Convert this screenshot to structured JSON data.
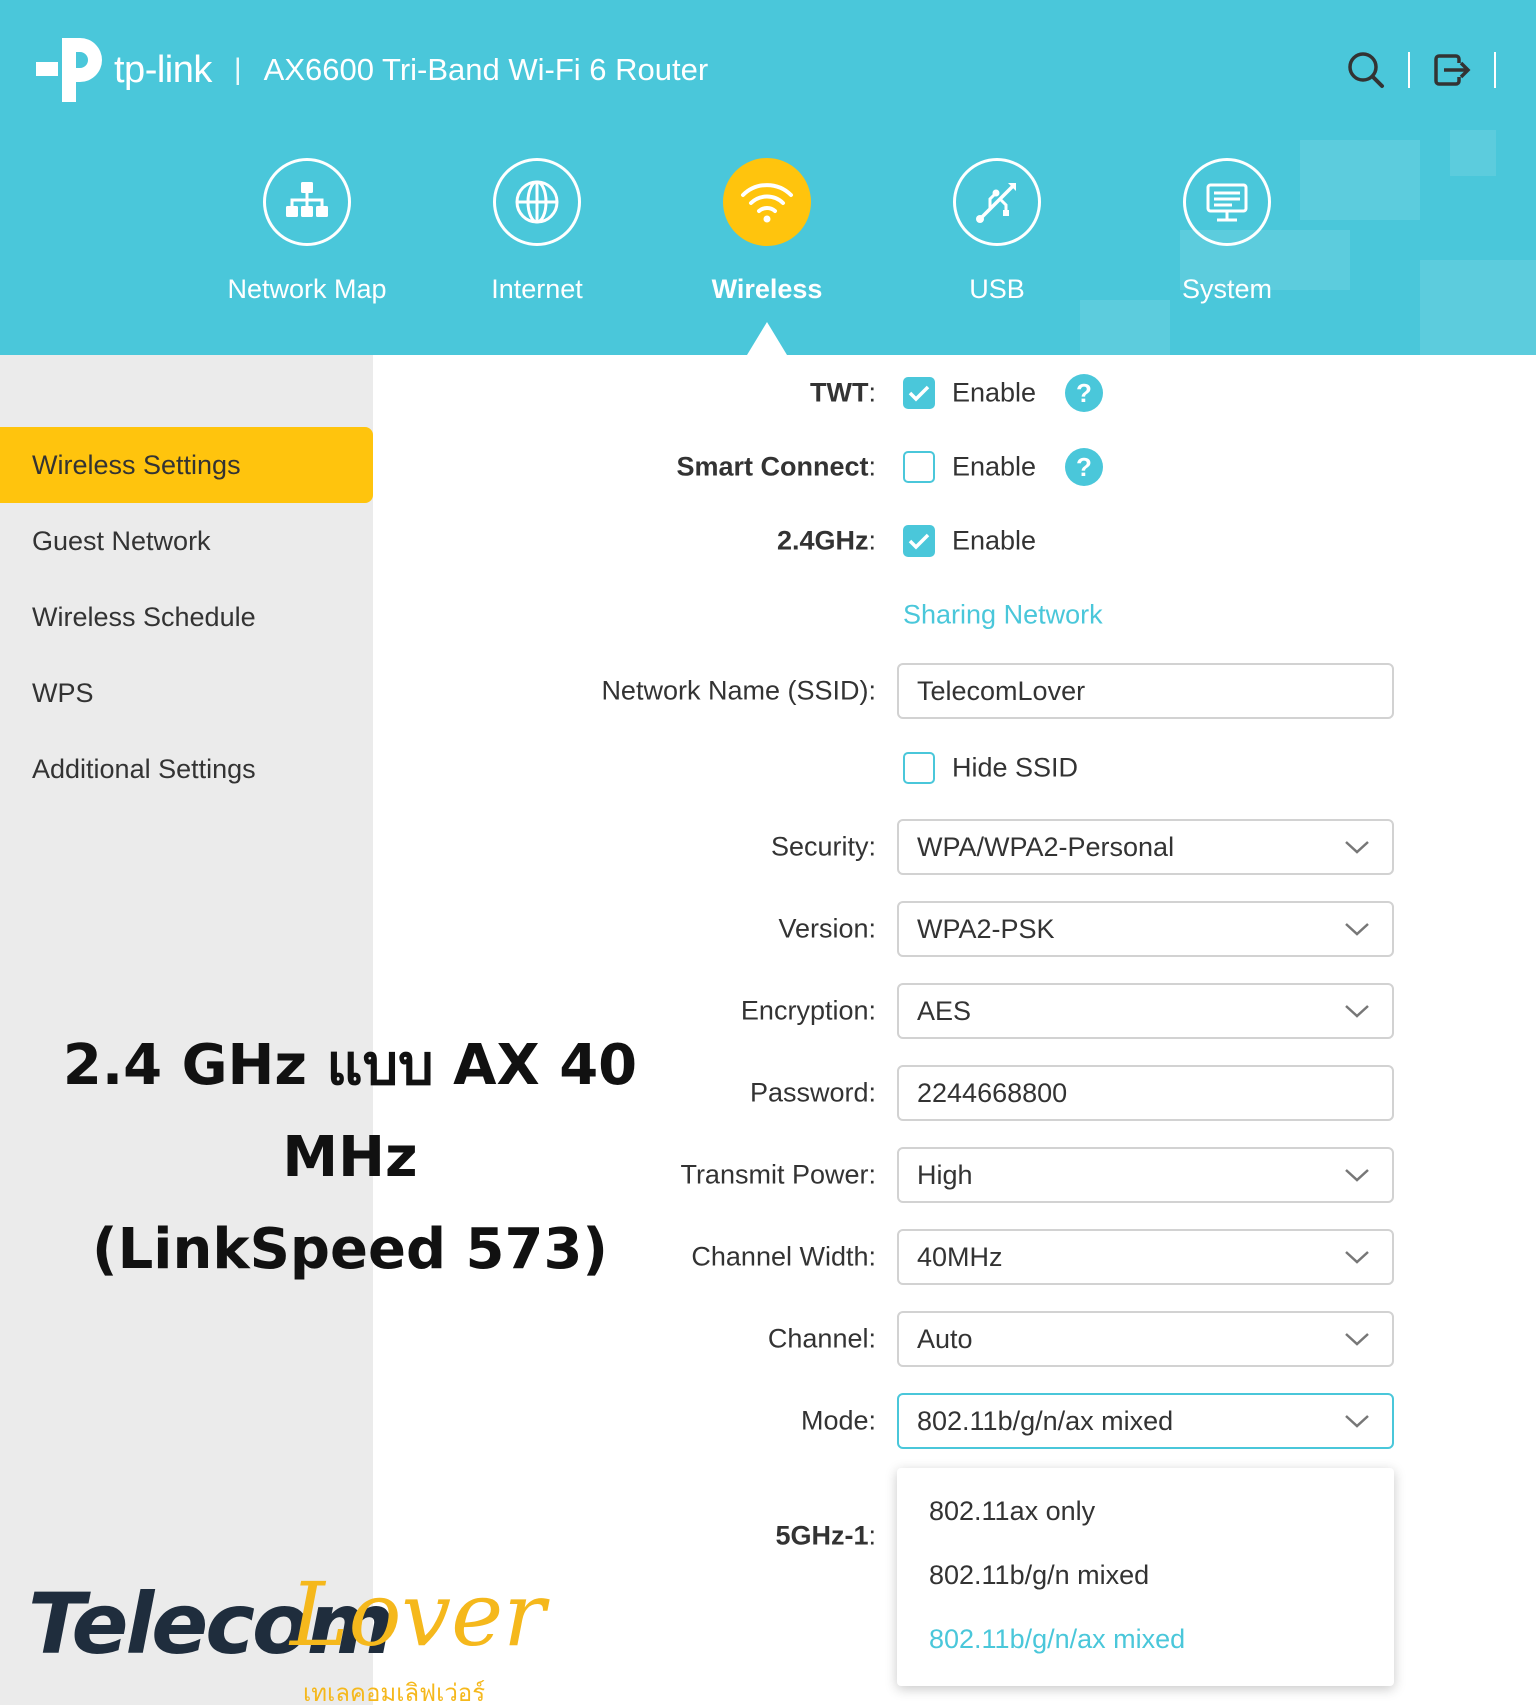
{
  "header": {
    "brand": "tp-link",
    "separator": "|",
    "title": "AX6600 Tri-Band Wi-Fi 6 Router",
    "tools": {
      "search_icon": "search-icon",
      "logout_icon": "logout-icon"
    }
  },
  "nav": {
    "items": [
      {
        "label": "Network Map",
        "icon": "network-map-icon"
      },
      {
        "label": "Internet",
        "icon": "globe-icon"
      },
      {
        "label": "Wireless",
        "icon": "wifi-icon",
        "active": true
      },
      {
        "label": "USB",
        "icon": "usb-icon"
      },
      {
        "label": "System",
        "icon": "system-icon"
      }
    ]
  },
  "sidebar": {
    "items": [
      {
        "label": "Wireless Settings",
        "active": true
      },
      {
        "label": "Guest Network"
      },
      {
        "label": "Wireless Schedule"
      },
      {
        "label": "WPS"
      },
      {
        "label": "Additional Settings"
      }
    ]
  },
  "form": {
    "twt": {
      "label": "TWT",
      "colon": ":",
      "checkbox_label": "Enable",
      "checked": true
    },
    "smart_connect": {
      "label": "Smart Connect",
      "colon": ":",
      "checkbox_label": "Enable",
      "checked": false
    },
    "band_24": {
      "label": "2.4GHz",
      "colon": ":",
      "checkbox_label": "Enable",
      "checked": true
    },
    "sharing_link": "Sharing Network",
    "ssid": {
      "label": "Network Name (SSID):",
      "value": "TelecomLover"
    },
    "hide_ssid": {
      "checkbox_label": "Hide SSID",
      "checked": false
    },
    "security": {
      "label": "Security:",
      "value": "WPA/WPA2-Personal"
    },
    "version": {
      "label": "Version:",
      "value": "WPA2-PSK"
    },
    "encryption": {
      "label": "Encryption:",
      "value": "AES"
    },
    "password": {
      "label": "Password:",
      "value": "2244668800"
    },
    "transmit_power": {
      "label": "Transmit Power:",
      "value": "High"
    },
    "channel_width": {
      "label": "Channel Width:",
      "value": "40MHz"
    },
    "channel": {
      "label": "Channel:",
      "value": "Auto"
    },
    "mode": {
      "label": "Mode:",
      "value": "802.11b/g/n/ax mixed",
      "options": [
        "802.11ax only",
        "802.11b/g/n mixed",
        "802.11b/g/n/ax mixed"
      ],
      "selected": "802.11b/g/n/ax mixed"
    },
    "band_5g1": {
      "label": "5GHz-1",
      "colon": ":"
    }
  },
  "overlay": {
    "line1": "2.4 GHz แบบ AX 40 MHz",
    "line2": "(LinkSpeed 573)"
  },
  "watermark": {
    "part1": "Telecom",
    "part2": "Lover",
    "thai": "เทเลคอมเลิฟเว่อร์"
  },
  "colors": {
    "header_bg": "#4ac7da",
    "accent_yellow": "#ffc40d",
    "accent_teal": "#4ac7da",
    "sidebar_bg": "#ebebeb"
  }
}
